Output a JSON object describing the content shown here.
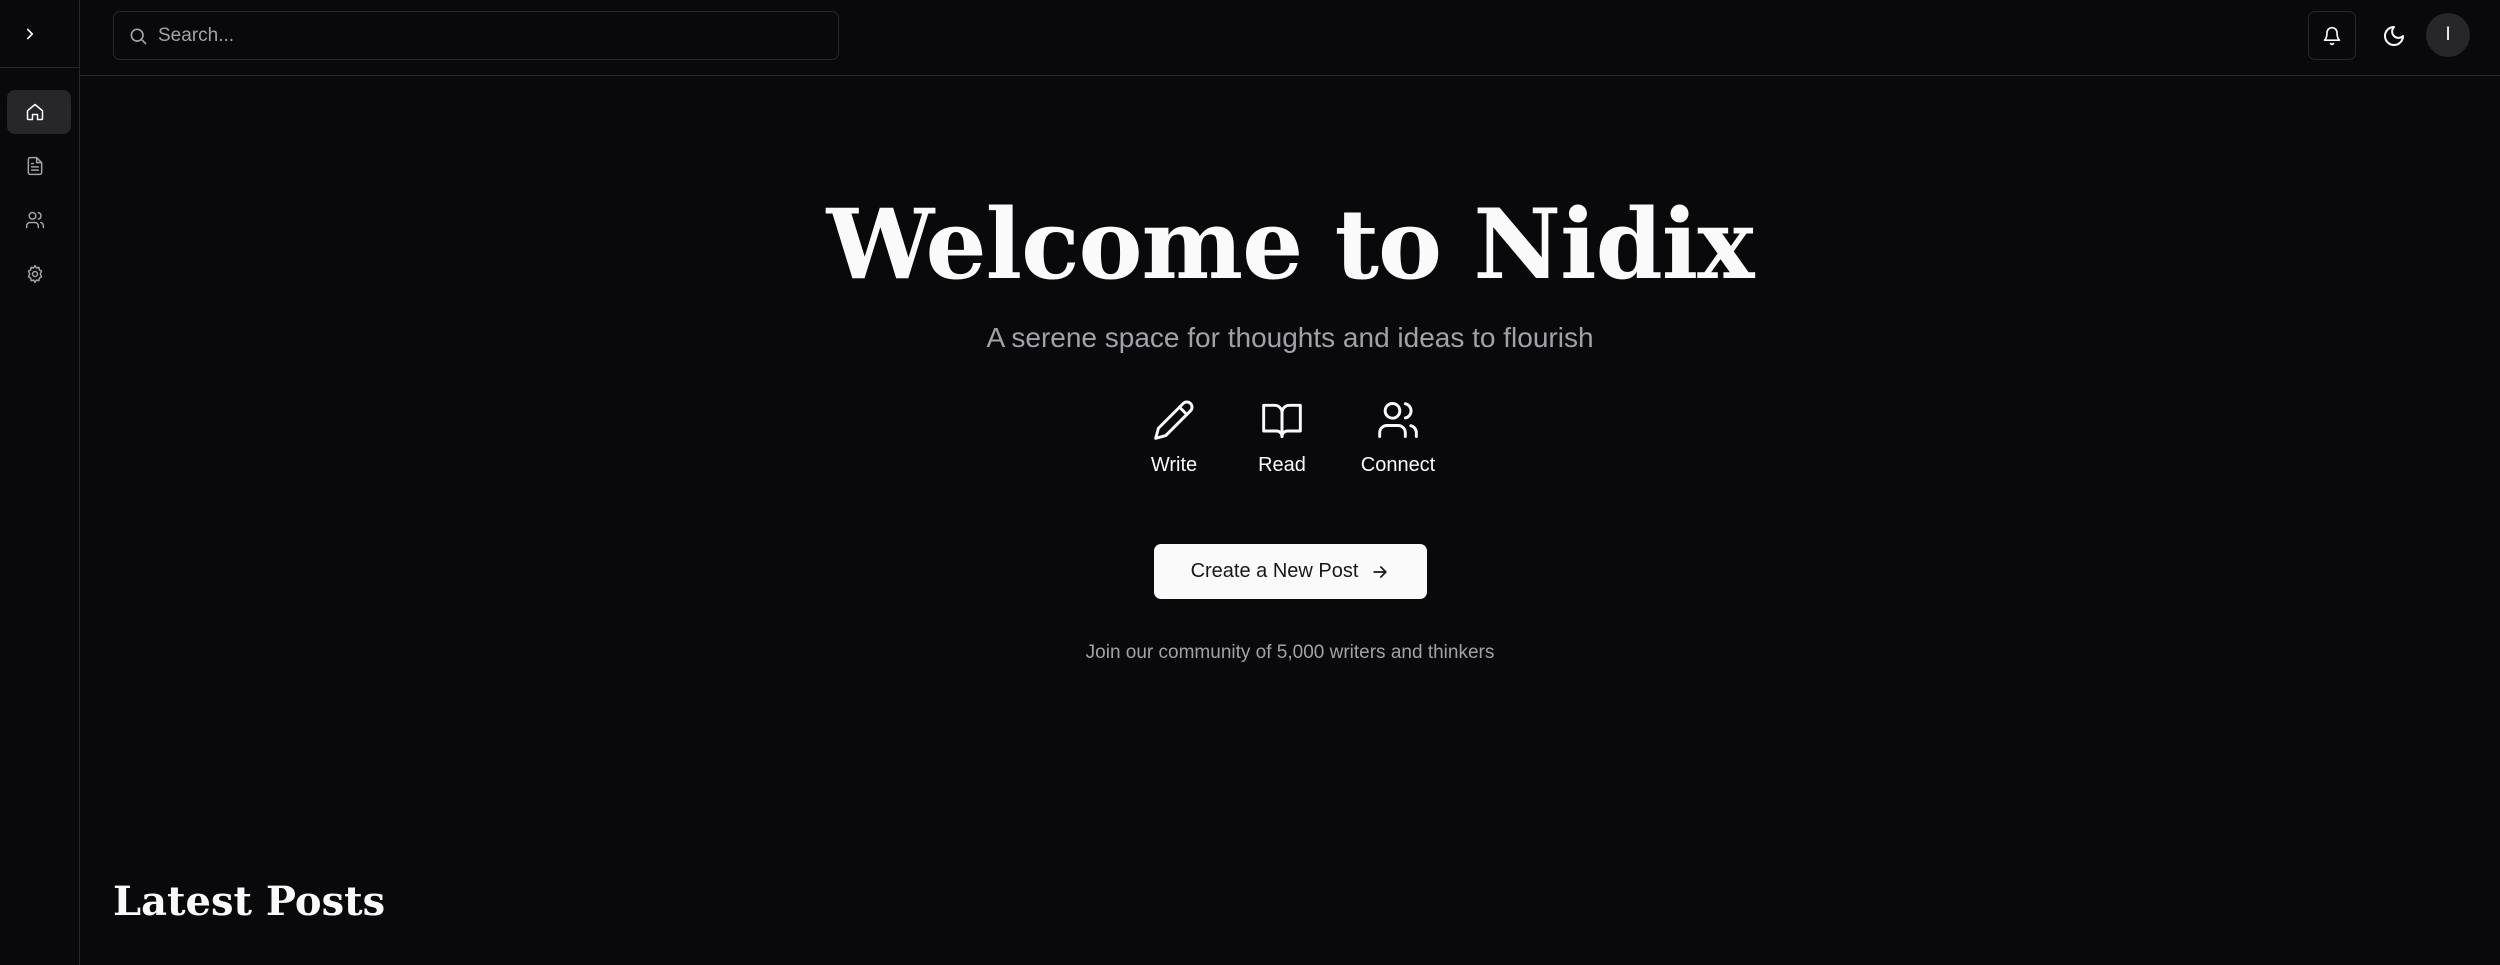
{
  "sidebar": {
    "toggle_icon": "chevron-right-icon",
    "items": [
      {
        "name": "home",
        "icon": "home-icon",
        "active": true
      },
      {
        "name": "posts",
        "icon": "file-text-icon",
        "active": false
      },
      {
        "name": "community",
        "icon": "users-icon",
        "active": false
      },
      {
        "name": "settings",
        "icon": "gear-icon",
        "active": false
      }
    ]
  },
  "topbar": {
    "search_placeholder": "Search...",
    "notifications_icon": "bell-icon",
    "theme_icon": "moon-icon",
    "avatar_initial": "I"
  },
  "hero": {
    "title": "Welcome to Nidix",
    "subtitle": "A serene space for thoughts and ideas to flourish",
    "features": [
      {
        "label": "Write",
        "icon": "pencil-icon"
      },
      {
        "label": "Read",
        "icon": "book-open-icon"
      },
      {
        "label": "Connect",
        "icon": "users-icon"
      }
    ],
    "cta_label": "Create a New Post",
    "community_text": "Join our community of 5,000 writers and thinkers"
  },
  "latest": {
    "heading": "Latest Posts"
  },
  "colors": {
    "background": "#09090b",
    "border": "#27272a",
    "text": "#fafafa",
    "muted": "#a1a1aa",
    "button_bg": "#fafafa"
  }
}
